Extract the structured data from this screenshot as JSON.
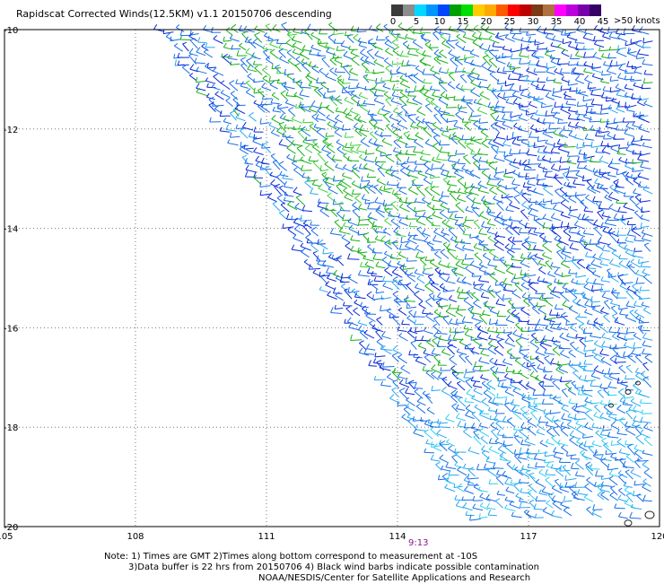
{
  "title": "Rapidscat Corrected Winds(12.5KM) v1.1 20150706 descending",
  "legend": {
    "unit": ">50 knots",
    "labels": [
      "0",
      "5",
      "10",
      "15",
      "20",
      "25",
      "30",
      "35",
      "40",
      "45"
    ],
    "colors": [
      "#3a3a3a",
      "#8c8c8c",
      "#00d8ff",
      "#0096ff",
      "#0046ff",
      "#00a000",
      "#00dd00",
      "#ffcc00",
      "#ffaa00",
      "#ff5a00",
      "#ff0000",
      "#c00000",
      "#7a3a16",
      "#b07040",
      "#ff00ff",
      "#bb00dd",
      "#7700aa",
      "#330066"
    ]
  },
  "map": {
    "lat_labels": [
      "-10",
      "-12",
      "-14",
      "-16",
      "-18",
      "-20"
    ],
    "lon_labels": [
      "105",
      "108",
      "111",
      "114",
      "117",
      "120"
    ],
    "lat_range": [
      -20,
      -10
    ],
    "lon_range": [
      105,
      120
    ]
  },
  "timestamp": "9:13",
  "notes": {
    "line1": "Note: 1) Times are GMT 2)Times along bottom correspond to measurement at -10S",
    "line2": "3)Data buffer is 22 hrs from 20150706 4) Black wind barbs indicate possible contamination",
    "line3": "NOAA/NESDIS/Center for Satellite Applications and Research"
  },
  "barb_palette": {
    "blue": "#0a28d8",
    "mid_blue": "#1a6ee8",
    "light_blue": "#28a8f0",
    "cyan": "#30d0f0",
    "green": "#18b018",
    "light_green": "#40d040",
    "yellow": "#e8e040",
    "dark": "#333333"
  }
}
